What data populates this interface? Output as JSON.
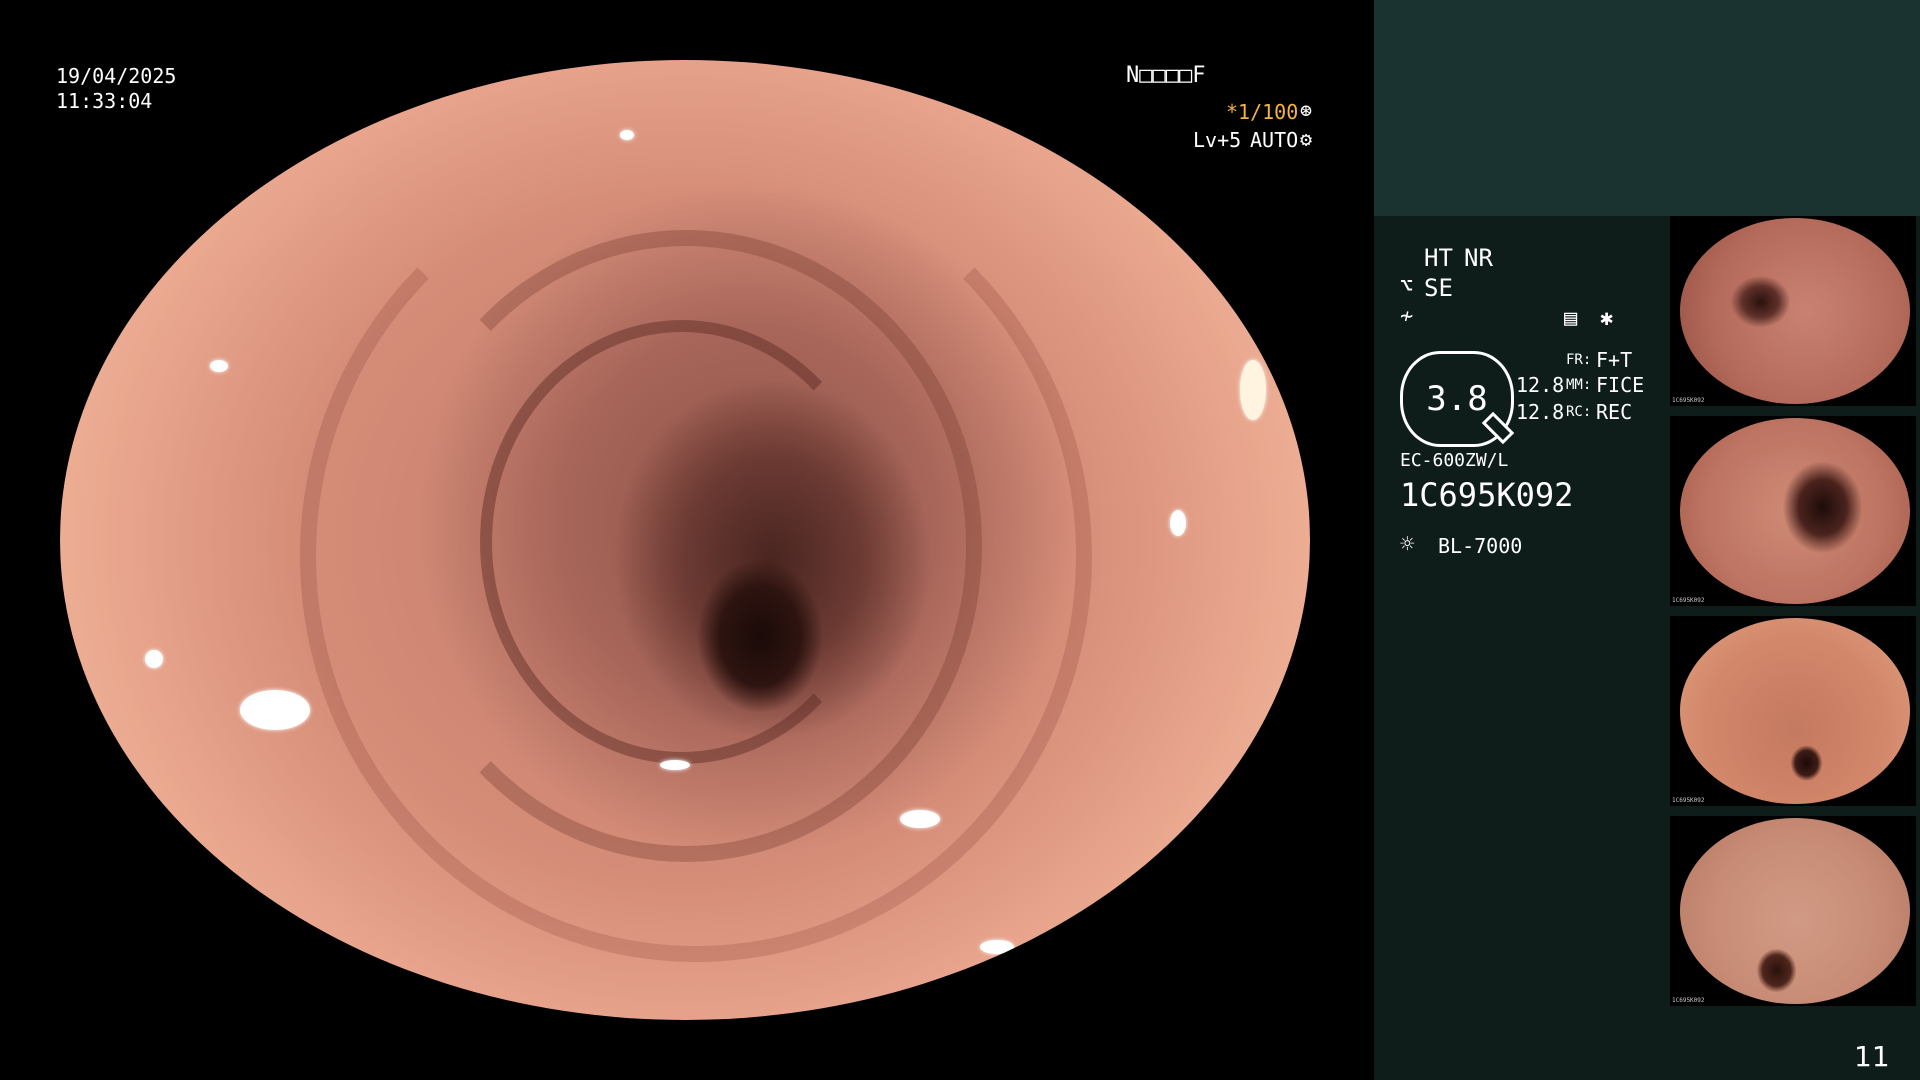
{
  "overlay": {
    "date": "19/04/2025",
    "time": "11:33:04",
    "patient_code": "N□□□□F",
    "shutter": "*1/100",
    "level": "Lv+5",
    "iris": "AUTO"
  },
  "panel": {
    "ht_label": "HT",
    "nr_label": "NR",
    "se_label": "SE",
    "zoom_value": "3.8",
    "fr_key": "FR:",
    "fr_value": "F+T",
    "mm_key": "MM:",
    "mm_value": "FICE",
    "rc_key": "RC:",
    "rc_value": "REC",
    "mm_number": "12.8",
    "rc_number": "12.8",
    "scope_model": "EC-600ZW/L",
    "scope_serial": "1C695K092",
    "light_source": "BL-7000",
    "image_count": "11"
  },
  "thumbnails": [
    {
      "caption": "1C695K092"
    },
    {
      "caption": "1C695K092"
    },
    {
      "caption": "1C695K092"
    },
    {
      "caption": "1C695K092"
    }
  ],
  "icons": {
    "shutter_icon": "aperture-icon",
    "iris_icon": "gear-icon",
    "sensor_icon": "scope-icon",
    "freeze_icon": "freeze-icon",
    "menu_icon": "menu-icon",
    "light_icon": "sun-icon"
  },
  "colors": {
    "accent": "#f5b342",
    "panel_bg": "#0e1c1a",
    "panel_top": "#1b3330",
    "mucosa": "#d58d78"
  }
}
